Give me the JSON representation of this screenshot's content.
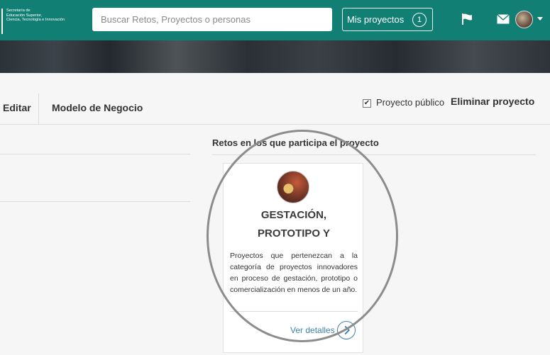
{
  "header": {
    "logo_lines": [
      "Secretaría de",
      "Educación Superior,",
      "Ciencia, Tecnología e Innovación"
    ],
    "search_placeholder": "Buscar Retos, Proyectos o personas",
    "mis_proyectos_label": "Mis proyectos",
    "mis_proyectos_count": "1",
    "icons": [
      "flag-icon",
      "mail-icon",
      "avatar",
      "chevron-down-icon"
    ],
    "accent_color": "#127f74"
  },
  "tabs": [
    {
      "label": "Editar"
    },
    {
      "label": "Modelo de Negocio"
    }
  ],
  "project_options": {
    "public_label": "Proyecto público",
    "public_checked": true,
    "delete_label": "Eliminar proyecto"
  },
  "challenges": {
    "section_title": "Retos en los que participa el proyecto",
    "card": {
      "title_line1": "GESTACIÓN,",
      "title_line2": "PROTOTIPO Y",
      "description": "Proyectos que pertenezcan a la categoría de proyectos innovadores en proceso de gestación, prototipo o comercialización en menos de un año.",
      "link_label": "Ver detalles",
      "link_color": "#3f7fb0"
    }
  }
}
